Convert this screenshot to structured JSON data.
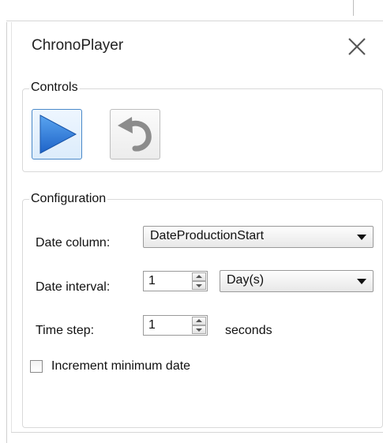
{
  "panel": {
    "title": "ChronoPlayer",
    "close_icon": "close-icon"
  },
  "controls": {
    "legend": "Controls",
    "play_icon": "play-icon",
    "reset_icon": "undo-icon",
    "play_color": "#2f7ed8"
  },
  "configuration": {
    "legend": "Configuration",
    "date_column_label": "Date column:",
    "date_column_value": "DateProductionStart",
    "date_interval_label": "Date interval:",
    "date_interval_value": "1",
    "date_interval_unit": "Day(s)",
    "time_step_label": "Time step:",
    "time_step_value": "1",
    "time_step_unit": "seconds",
    "increment_label": "Increment minimum date",
    "increment_checked": false
  }
}
